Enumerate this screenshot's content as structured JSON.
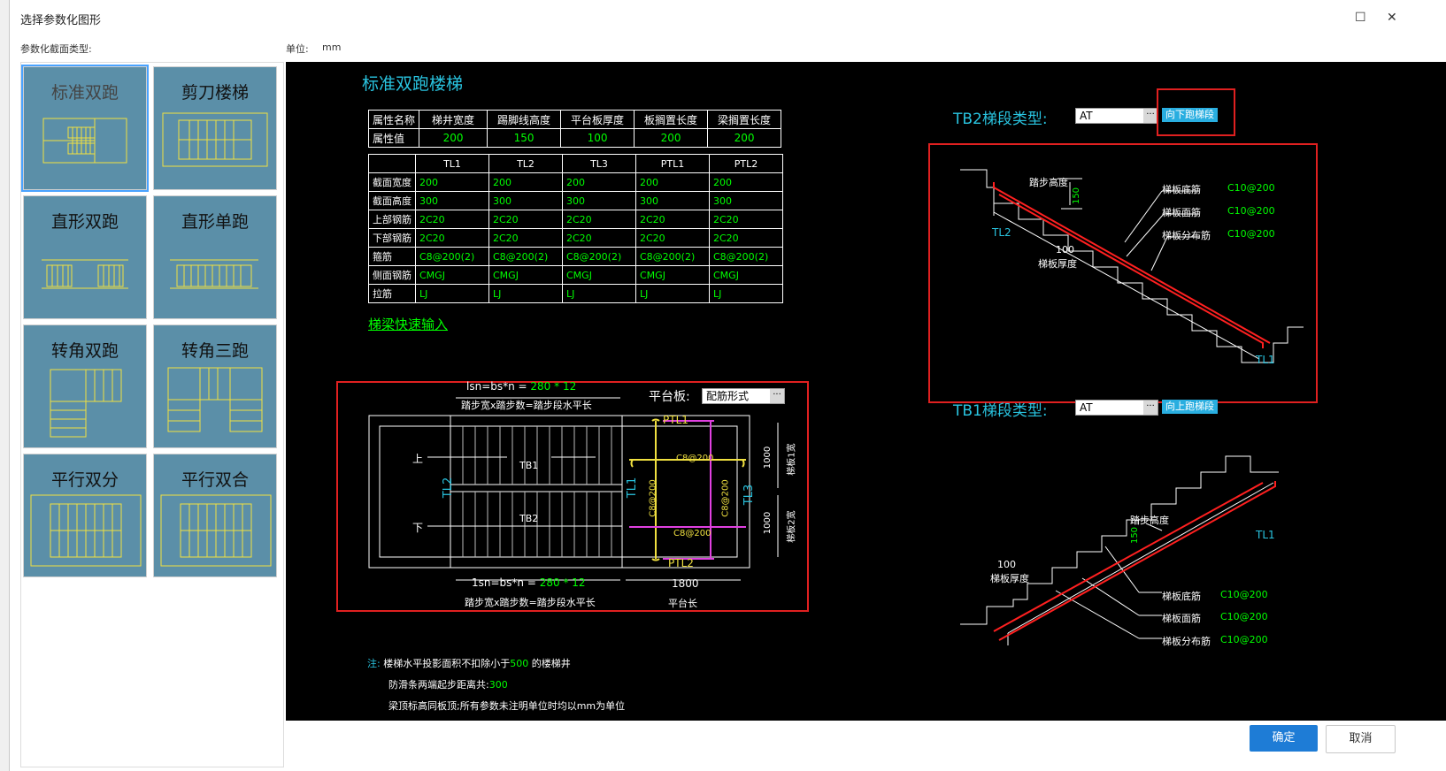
{
  "window": {
    "title": "选择参数化图形",
    "maximize_icon": "maximize-icon",
    "close_icon": "close-icon"
  },
  "header": {
    "section_label": "参数化截面类型:",
    "unit_label": "单位:",
    "unit_value": "mm"
  },
  "thumbnails": [
    {
      "label": "标准双跑",
      "selected": true
    },
    {
      "label": "剪刀楼梯",
      "selected": false
    },
    {
      "label": "直形双跑",
      "selected": false
    },
    {
      "label": "直形单跑",
      "selected": false
    },
    {
      "label": "转角双跑",
      "selected": false
    },
    {
      "label": "转角三跑",
      "selected": false
    },
    {
      "label": "平行双分",
      "selected": false
    },
    {
      "label": "平行双合",
      "selected": false
    }
  ],
  "drawing": {
    "title": "标准双跑楼梯",
    "prop_table": {
      "headers": [
        "属性名称",
        "梯井宽度",
        "踢脚线高度",
        "平台板厚度",
        "板搁置长度",
        "梁搁置长度"
      ],
      "row_label": "属性值",
      "values": [
        "200",
        "150",
        "100",
        "200",
        "200"
      ]
    },
    "beam_table": {
      "columns": [
        "TL1",
        "TL2",
        "TL3",
        "PTL1",
        "PTL2"
      ],
      "rows": [
        {
          "label": "截面宽度",
          "values": [
            "200",
            "200",
            "200",
            "200",
            "200"
          ]
        },
        {
          "label": "截面高度",
          "values": [
            "300",
            "300",
            "300",
            "300",
            "300"
          ]
        },
        {
          "label": "上部钢筋",
          "values": [
            "2C20",
            "2C20",
            "2C20",
            "2C20",
            "2C20"
          ]
        },
        {
          "label": "下部钢筋",
          "values": [
            "2C20",
            "2C20",
            "2C20",
            "2C20",
            "2C20"
          ]
        },
        {
          "label": "箍筋",
          "values": [
            "C8@200(2)",
            "C8@200(2)",
            "C8@200(2)",
            "C8@200(2)",
            "C8@200(2)"
          ]
        },
        {
          "label": "侧面钢筋",
          "values": [
            "CMGJ",
            "CMGJ",
            "CMGJ",
            "CMGJ",
            "CMGJ"
          ]
        },
        {
          "label": "拉筋",
          "values": [
            "LJ",
            "LJ",
            "LJ",
            "LJ",
            "LJ"
          ]
        }
      ]
    },
    "quick_input_link": "梯梁快速输入",
    "plan": {
      "top_formula_a": "lsn=bs*n = ",
      "top_formula_b": "280 * 12",
      "top_caption": "踏步宽x踏步数=踏步段水平长",
      "platform_label": "平台板:",
      "platform_value": "配筋形式",
      "up": "上",
      "down": "下",
      "tb1": "TB1",
      "tb2": "TB2",
      "tl1": "TL1",
      "tl2": "TL2",
      "tl3": "TL3",
      "ptl1": "PTL1",
      "ptl2": "PTL2",
      "rebar_top": "C8@200",
      "rebar_bottom": "C8@200",
      "rebar_left": "C8@200",
      "rebar_right": "C8@200",
      "dim_1000_a": "1000",
      "dim_1000_b": "1000",
      "width1": "梯板1宽",
      "width2": "梯板2宽",
      "bot_formula_a": "1sn=bs*n = ",
      "bot_formula_b": "280 * 12",
      "bot_caption": "踏步宽x踏步数=踏步段水平长",
      "platform_len_value": "1800",
      "platform_len_label": "平台长"
    },
    "notes": {
      "prefix": "注:",
      "line1_a": "楼梯水平投影面积不扣除小于",
      "line1_b": "500",
      "line1_c": " 的楼梯井",
      "line2_a": "防滑条两端起步距离共:",
      "line2_b": "300",
      "line3": "梁顶标高同板顶;所有参数未注明单位时均以mm为单位"
    },
    "tb2": {
      "label": "TB2梯段类型:",
      "value": "AT",
      "button": "向下跑梯段",
      "step_height": "踏步高度",
      "step_height_value": "150",
      "bottom_rebar_label": "梯板底筋",
      "bottom_rebar_value": "C10@200",
      "top_rebar_label": "梯板面筋",
      "top_rebar_value": "C10@200",
      "dist_rebar_label": "梯板分布筋",
      "dist_rebar_value": "C10@200",
      "thickness_value": "100",
      "thickness_label": "梯板厚度",
      "tl_left": "TL2",
      "tl_right": "TL1"
    },
    "tb1": {
      "label": "TB1梯段类型:",
      "value": "AT",
      "button": "向上跑梯段",
      "step_height": "踏步高度",
      "step_height_value": "150",
      "thickness_value": "100",
      "thickness_label": "梯板厚度",
      "bottom_rebar_label": "梯板底筋",
      "bottom_rebar_value": "C10@200",
      "top_rebar_label": "梯板面筋",
      "top_rebar_value": "C10@200",
      "dist_rebar_label": "梯板分布筋",
      "dist_rebar_value": "C10@200",
      "tl_right": "TL1"
    }
  },
  "footer": {
    "ok": "确定",
    "cancel": "取消"
  },
  "colors": {
    "canvas": "#000000",
    "thumb_bg": "#5b8fa8",
    "cyan_text": "#29c4e0",
    "highlight": "#e02020",
    "ok_button": "#1e7cd6"
  }
}
